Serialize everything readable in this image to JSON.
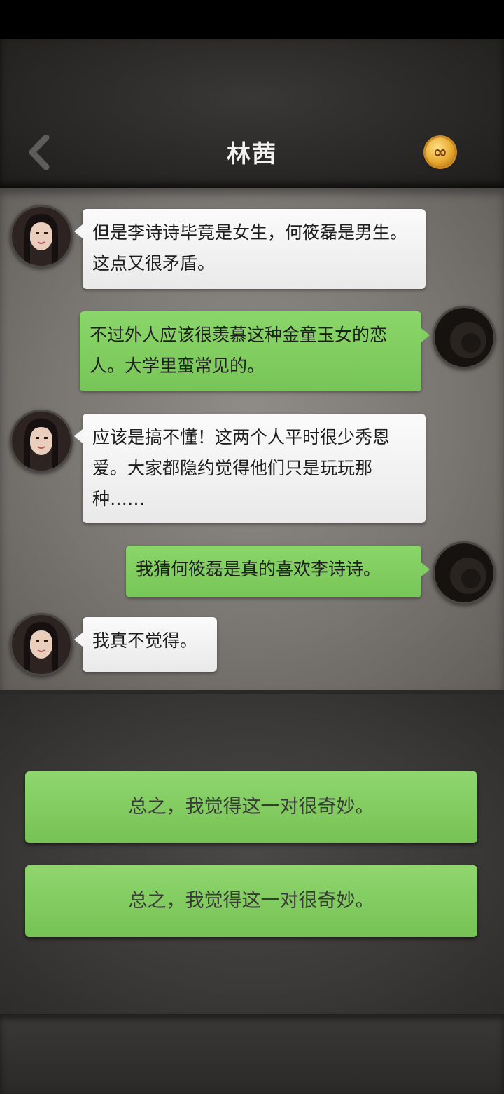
{
  "header": {
    "title": "林茜",
    "back_icon": "chevron-left-icon",
    "coin_icon": "infinity-coin-icon",
    "coin_symbol": "∞"
  },
  "messages": [
    {
      "sender": "other",
      "text": "但是李诗诗毕竟是女生，何筱磊是男生。这点又很矛盾。"
    },
    {
      "sender": "me",
      "text": "不过外人应该很羡慕这种金童玉女的恋人。大学里蛮常见的。"
    },
    {
      "sender": "other",
      "text": "应该是搞不懂！这两个人平时很少秀恩爱。大家都隐约觉得他们只是玩玩那种……"
    },
    {
      "sender": "me",
      "text": "我猜何筱磊是真的喜欢李诗诗。"
    },
    {
      "sender": "other",
      "text": "我真不觉得。"
    }
  ],
  "choices": [
    {
      "label": "总之，我觉得这一对很奇妙。"
    },
    {
      "label": "总之，我觉得这一对很奇妙。"
    }
  ],
  "colors": {
    "bubble_other": "#f4f4f4",
    "bubble_me": "#82cf61",
    "choice": "#82cf61",
    "coin": "#e8a92e"
  }
}
